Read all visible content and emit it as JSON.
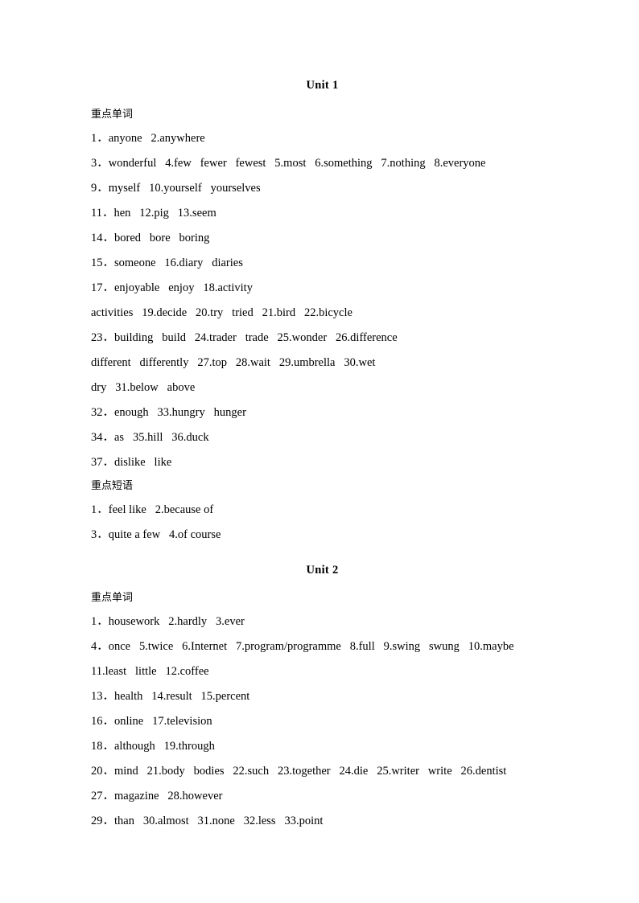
{
  "document": {
    "units": [
      {
        "heading": "Unit 1",
        "sections": [
          {
            "heading": "重点单词",
            "lines": [
              "1．anyone   2.anywhere",
              "3．wonderful   4.few   fewer   fewest   5.most   6.something   7.nothing   8.everyone",
              "9．myself   10.yourself   yourselves",
              "11．hen   12.pig   13.seem",
              "14．bored   bore   boring",
              "15．someone   16.diary   diaries",
              "17．enjoyable   enjoy   18.activity",
              "activities   19.decide   20.try   tried   21.bird   22.bicycle",
              "23．building   build   24.trader   trade   25.wonder   26.difference",
              "different   differently   27.top   28.wait   29.umbrella   30.wet",
              "dry   31.below   above",
              "32．enough   33.hungry   hunger",
              "34．as   35.hill   36.duck",
              "37．dislike   like"
            ]
          },
          {
            "heading": "重点短语",
            "lines": [
              "1．feel like   2.because of",
              "3．quite a few   4.of course"
            ]
          }
        ]
      },
      {
        "heading": "Unit 2",
        "sections": [
          {
            "heading": "重点单词",
            "lines": [
              "1．housework   2.hardly   3.ever",
              "4．once   5.twice   6.Internet   7.program/programme   8.full   9.swing   swung   10.maybe",
              "11.least   little   12.coffee",
              "13．health   14.result   15.percent",
              "16．online   17.television",
              "18．although   19.through",
              "20．mind   21.body   bodies   22.such   23.together   24.die   25.writer   write   26.dentist",
              "27．magazine   28.however",
              "29．than   30.almost   31.none   32.less   33.point"
            ]
          }
        ]
      }
    ]
  }
}
